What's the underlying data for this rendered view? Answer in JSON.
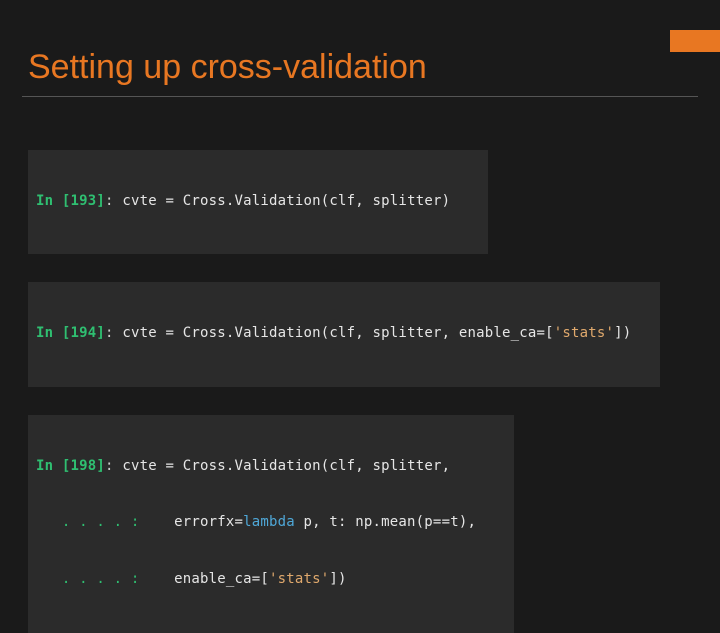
{
  "slide": {
    "title": "Setting up cross-validation"
  },
  "code": {
    "block1": {
      "prompt_in": "In ",
      "prompt_num": "[193]",
      "colon": ": ",
      "var": "cvte",
      "eq": " = ",
      "call": "Cross.Validation(clf, splitter)"
    },
    "block2": {
      "prompt_in": "In ",
      "prompt_num": "[194]",
      "colon": ": ",
      "var": "cvte",
      "eq": " = ",
      "call_a": "Cross.Validation(clf, splitter, enable_ca=[",
      "str": "'stats'",
      "call_b": "])"
    },
    "block3": {
      "prompt_in": "In ",
      "prompt_num": "[198]",
      "colon": ": ",
      "var": "cvte",
      "eq": " = ",
      "line1_tail": "Cross.Validation(clf, splitter,",
      "cont": "   . . . . :    ",
      "line2_a": "errorfx=",
      "line2_lambda": "lambda",
      "line2_b": " p, t: np.mean(p==t),",
      "line3_a": "enable_ca=[",
      "line3_str": "'stats'",
      "line3_b": "])"
    }
  }
}
